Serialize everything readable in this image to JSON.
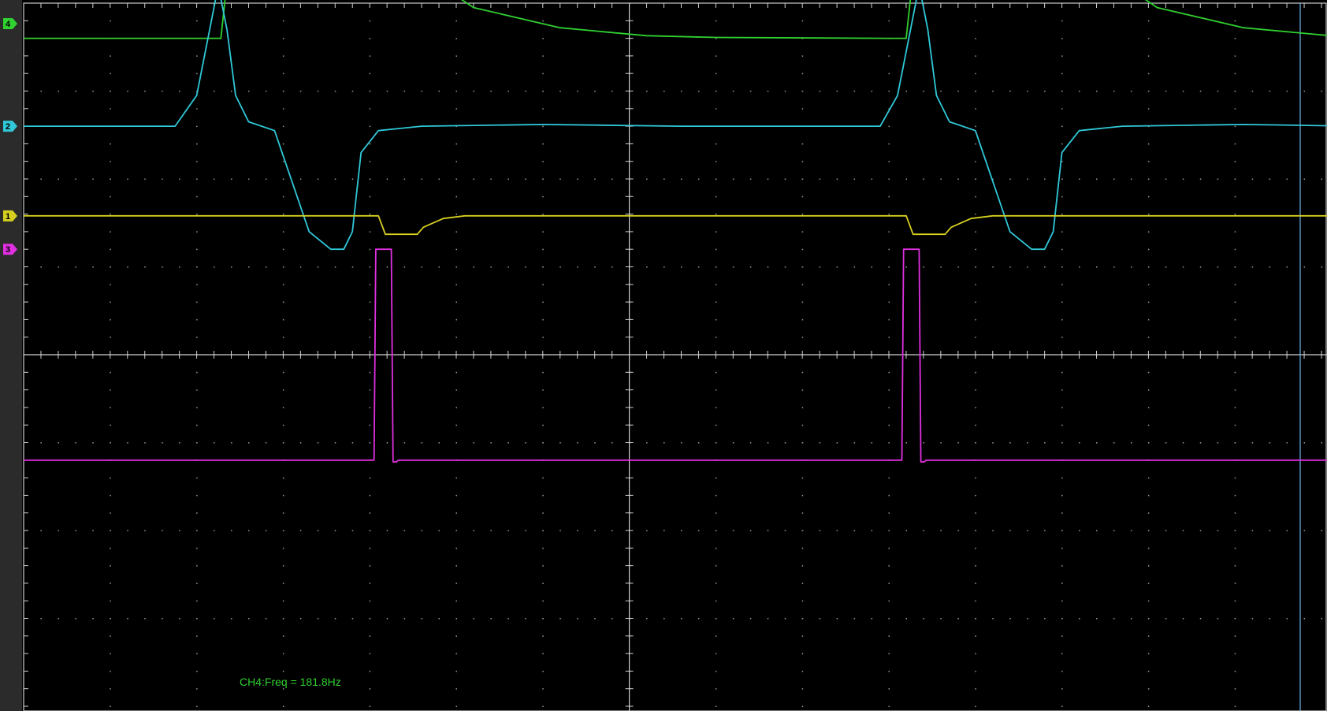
{
  "colors": {
    "background": "#000000",
    "rail": "#2b2b2b",
    "grid": "#cfcfcf",
    "ch1": "#d6d020",
    "ch2": "#30c8d8",
    "ch3": "#e030e0",
    "ch4": "#30d030",
    "cursor": "#6fb4e8"
  },
  "channels": [
    {
      "id": "ch4",
      "marker_label": "4",
      "name": "CH4"
    },
    {
      "id": "ch2",
      "marker_label": "2",
      "name": "CH2"
    },
    {
      "id": "ch1",
      "marker_label": "1",
      "name": "CH1"
    },
    {
      "id": "ch3",
      "marker_label": "3",
      "name": "CH3"
    }
  ],
  "measurement": {
    "text": "CH4:Freq = 181.8Hz"
  },
  "chart_data": {
    "type": "line",
    "title": "",
    "xlabel": "",
    "ylabel": "",
    "grid": true,
    "x_divisions": 14,
    "y_divisions": 8,
    "xlim": [
      0,
      14
    ],
    "ylim": [
      0,
      8
    ],
    "series": [
      {
        "name": "4",
        "color": "#30d030",
        "x": [
          0.0,
          2.28,
          2.36,
          4.62,
          5.2,
          6.2,
          7.2,
          8.0,
          10.0,
          10.2,
          10.28,
          12.54,
          13.1,
          14.1,
          15.1,
          15.45
        ],
        "values": [
          7.6,
          7.6,
          8.33,
          8.33,
          7.95,
          7.72,
          7.63,
          7.61,
          7.6,
          7.6,
          8.33,
          8.33,
          7.95,
          7.72,
          7.63,
          7.62
        ]
      },
      {
        "name": "2",
        "color": "#30c8d8",
        "x": [
          0.0,
          1.75,
          2.0,
          2.15,
          2.25,
          2.35,
          2.45,
          2.6,
          2.9,
          3.3,
          3.55,
          3.7,
          3.8,
          3.9,
          4.1,
          4.6,
          6.0,
          7.6,
          9.9,
          10.1,
          10.25,
          10.35,
          10.45,
          10.55,
          10.7,
          11.0,
          11.4,
          11.65,
          11.8,
          11.9,
          12.0,
          12.2,
          12.7,
          14.1,
          15.45
        ],
        "values": [
          6.6,
          6.6,
          6.95,
          7.7,
          8.2,
          7.7,
          6.95,
          6.65,
          6.55,
          5.4,
          5.2,
          5.2,
          5.4,
          6.3,
          6.55,
          6.6,
          6.62,
          6.6,
          6.6,
          6.95,
          7.7,
          8.2,
          7.7,
          6.95,
          6.65,
          6.55,
          5.4,
          5.2,
          5.2,
          5.4,
          6.3,
          6.55,
          6.6,
          6.62,
          6.6
        ]
      },
      {
        "name": "1",
        "color": "#d6d020",
        "x": [
          0.0,
          4.1,
          4.18,
          4.55,
          4.62,
          4.85,
          5.1,
          5.5,
          10.2,
          10.28,
          10.65,
          10.72,
          10.95,
          11.2,
          11.6,
          15.45
        ],
        "values": [
          5.58,
          5.58,
          5.37,
          5.37,
          5.45,
          5.55,
          5.58,
          5.58,
          5.58,
          5.37,
          5.37,
          5.45,
          5.55,
          5.58,
          5.58,
          5.58
        ]
      },
      {
        "name": "3",
        "color": "#e030e0",
        "x": [
          0.0,
          4.05,
          4.07,
          4.25,
          4.27,
          4.31,
          4.33,
          10.15,
          10.17,
          10.35,
          10.37,
          10.41,
          10.43,
          15.45
        ],
        "values": [
          2.8,
          2.8,
          5.2,
          5.2,
          2.78,
          2.78,
          2.8,
          2.8,
          5.2,
          5.2,
          2.78,
          2.78,
          2.8,
          2.8
        ]
      }
    ],
    "annotations": [
      "CH4:Freq = 181.8Hz"
    ]
  }
}
